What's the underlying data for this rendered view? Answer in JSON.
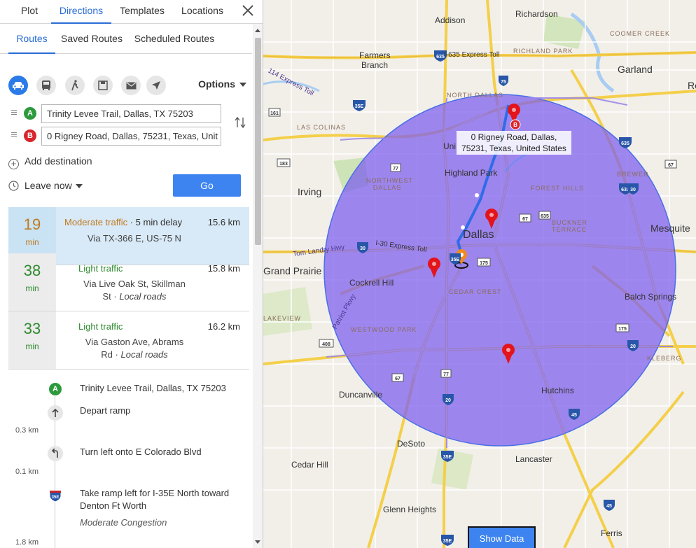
{
  "tabs": [
    "Plot",
    "Directions",
    "Templates",
    "Locations"
  ],
  "sub_tabs": [
    "Routes",
    "Saved Routes",
    "Scheduled Routes"
  ],
  "mode_icons": [
    "car-icon",
    "bus-icon",
    "walk-icon",
    "save-icon",
    "mail-icon",
    "navigate-icon"
  ],
  "options_label": "Options",
  "waypoints": [
    {
      "badge": "A",
      "color": "#2c9a3c",
      "value": "Trinity Levee Trail, Dallas, TX 75203"
    },
    {
      "badge": "B",
      "color": "#d8262c",
      "value": "0 Rigney Road, Dallas, 75231, Texas, Unit"
    }
  ],
  "add_destination": "Add destination",
  "leave_now": "Leave now",
  "go_label": "Go",
  "routes": [
    {
      "mins": "19",
      "min_label": "min",
      "traffic": "Moderate traffic",
      "delay": "5 min delay",
      "distance": "15.6 km",
      "via": "Via TX-366 E, US-75 N",
      "via2": "",
      "roads": "",
      "traffic_color": "#c07a1e",
      "time_color": "#c07a1e",
      "selected": true
    },
    {
      "mins": "38",
      "min_label": "min",
      "traffic": "Light traffic",
      "delay": "",
      "distance": "15.8 km",
      "via": "Via Live Oak St, Skillman",
      "via2": "St",
      "roads": "Local roads",
      "traffic_color": "#2e8a2e",
      "time_color": "#2e8a2e",
      "selected": false
    },
    {
      "mins": "33",
      "min_label": "min",
      "traffic": "Light traffic",
      "delay": "",
      "distance": "16.2 km",
      "via": "Via Gaston Ave, Abrams",
      "via2": "Rd",
      "roads": "Local roads",
      "traffic_color": "#2e8a2e",
      "time_color": "#2e8a2e",
      "selected": false
    }
  ],
  "steps": [
    {
      "icon": "waypoint-a-icon",
      "text": "Trinity Levee Trail, Dallas, TX 75203",
      "dist": ""
    },
    {
      "icon": "arrow-up-icon",
      "text": "Depart ramp",
      "dist": "0.3 km"
    },
    {
      "icon": "turn-left-icon",
      "text": "Turn left onto E Colorado Blvd",
      "dist": "0.1 km"
    },
    {
      "icon": "interstate-35e-icon",
      "text": "Take ramp left for I-35E North toward Denton Ft Worth",
      "dist": "1.8 km",
      "note": "Moderate Congestion"
    }
  ],
  "map": {
    "callout": "0 Rigney Road, Dallas, 75231, Texas, United States",
    "show_data": "Show Data",
    "radius_color": "#7b5cf0",
    "labels": [
      {
        "text": "Addison"
      },
      {
        "text": "Richardson"
      },
      {
        "text": "COOMER CREEK"
      },
      {
        "text": "Farmers"
      },
      {
        "text": "Branch"
      },
      {
        "text": "I-635 Express Toll"
      },
      {
        "text": "RICHLAND PARK"
      },
      {
        "text": "Garland"
      },
      {
        "text": "NORTH DALLAS"
      },
      {
        "text": "LAS COLINAS"
      },
      {
        "text": "Uni"
      },
      {
        "text": "Highland Park"
      },
      {
        "text": "Irving"
      },
      {
        "text": "NORTHWEST DALLAS"
      },
      {
        "text": "FOREST HILLS"
      },
      {
        "text": "BUCKNER TERRACE"
      },
      {
        "text": "Mesquite"
      },
      {
        "text": "Tom Landry Hwy"
      },
      {
        "text": "I-30 Express Toll"
      },
      {
        "text": "Dallas"
      },
      {
        "text": "Grand Prairie"
      },
      {
        "text": "Cockrell Hill"
      },
      {
        "text": "CEDAR CREST"
      },
      {
        "text": "Balch Springs"
      },
      {
        "text": "LAKEVIEW"
      },
      {
        "text": "WESTWOOD PARK"
      },
      {
        "text": "Patriot Pkwy"
      },
      {
        "text": "KLEBERG"
      },
      {
        "text": "Duncanville"
      },
      {
        "text": "Hutchins"
      },
      {
        "text": "DeSoto"
      },
      {
        "text": "Lancaster"
      },
      {
        "text": "Cedar Hill"
      },
      {
        "text": "Glenn Heights"
      },
      {
        "text": "Ferris"
      },
      {
        "text": "BREWER"
      },
      {
        "text": "114 Express Toll"
      },
      {
        "text": "Re"
      }
    ]
  }
}
